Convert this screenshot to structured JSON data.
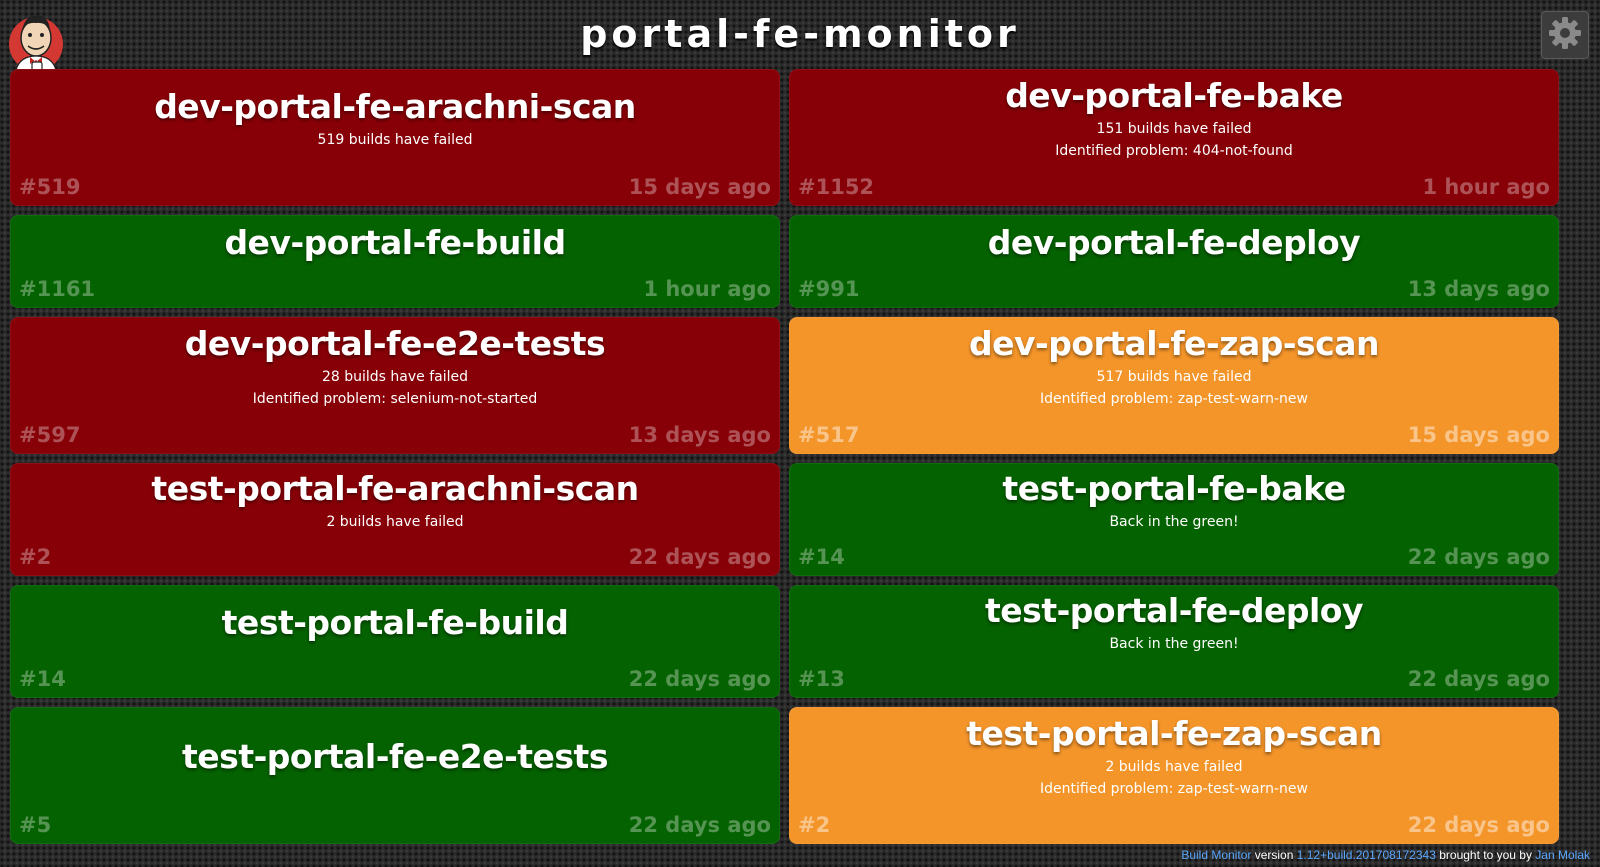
{
  "header": {
    "title": "portal-fe-monitor",
    "logo_icon": "jenkins-butler-icon",
    "settings_icon": "gear-icon"
  },
  "colors": {
    "failing": "#870007",
    "successful": "#056201",
    "unstable": "#f4952a",
    "link": "#5aa7ff"
  },
  "jobs": [
    {
      "name": "dev-portal-fe-arachni-scan",
      "status": "failing",
      "details": [
        "519 builds have failed"
      ],
      "build": "#519",
      "time": "15 days ago"
    },
    {
      "name": "dev-portal-fe-bake",
      "status": "failing",
      "details": [
        "151 builds have failed",
        "Identified problem: 404-not-found"
      ],
      "build": "#1152",
      "time": "1 hour ago"
    },
    {
      "name": "dev-portal-fe-build",
      "status": "successful",
      "details": [],
      "build": "#1161",
      "time": "1 hour ago"
    },
    {
      "name": "dev-portal-fe-deploy",
      "status": "successful",
      "details": [],
      "build": "#991",
      "time": "13 days ago"
    },
    {
      "name": "dev-portal-fe-e2e-tests",
      "status": "failing",
      "details": [
        "28 builds have failed",
        "Identified problem: selenium-not-started"
      ],
      "build": "#597",
      "time": "13 days ago"
    },
    {
      "name": "dev-portal-fe-zap-scan",
      "status": "unstable",
      "details": [
        "517 builds have failed",
        "Identified problem: zap-test-warn-new"
      ],
      "build": "#517",
      "time": "15 days ago"
    },
    {
      "name": "test-portal-fe-arachni-scan",
      "status": "failing",
      "details": [
        "2 builds have failed"
      ],
      "build": "#2",
      "time": "22 days ago"
    },
    {
      "name": "test-portal-fe-bake",
      "status": "successful",
      "details": [
        "Back in the green!"
      ],
      "build": "#14",
      "time": "22 days ago"
    },
    {
      "name": "test-portal-fe-build",
      "status": "successful",
      "details": [],
      "build": "#14",
      "time": "22 days ago"
    },
    {
      "name": "test-portal-fe-deploy",
      "status": "successful",
      "details": [
        "Back in the green!"
      ],
      "build": "#13",
      "time": "22 days ago"
    },
    {
      "name": "test-portal-fe-e2e-tests",
      "status": "successful",
      "details": [],
      "build": "#5",
      "time": "22 days ago"
    },
    {
      "name": "test-portal-fe-zap-scan",
      "status": "unstable",
      "details": [
        "2 builds have failed",
        "Identified problem: zap-test-warn-new"
      ],
      "build": "#2",
      "time": "22 days ago"
    }
  ],
  "footer": {
    "app_name": "Build Monitor",
    "version_label": "version",
    "version": "1.12+build.201708172343",
    "brought_by": "brought to you by",
    "author": "Jan Molak"
  }
}
